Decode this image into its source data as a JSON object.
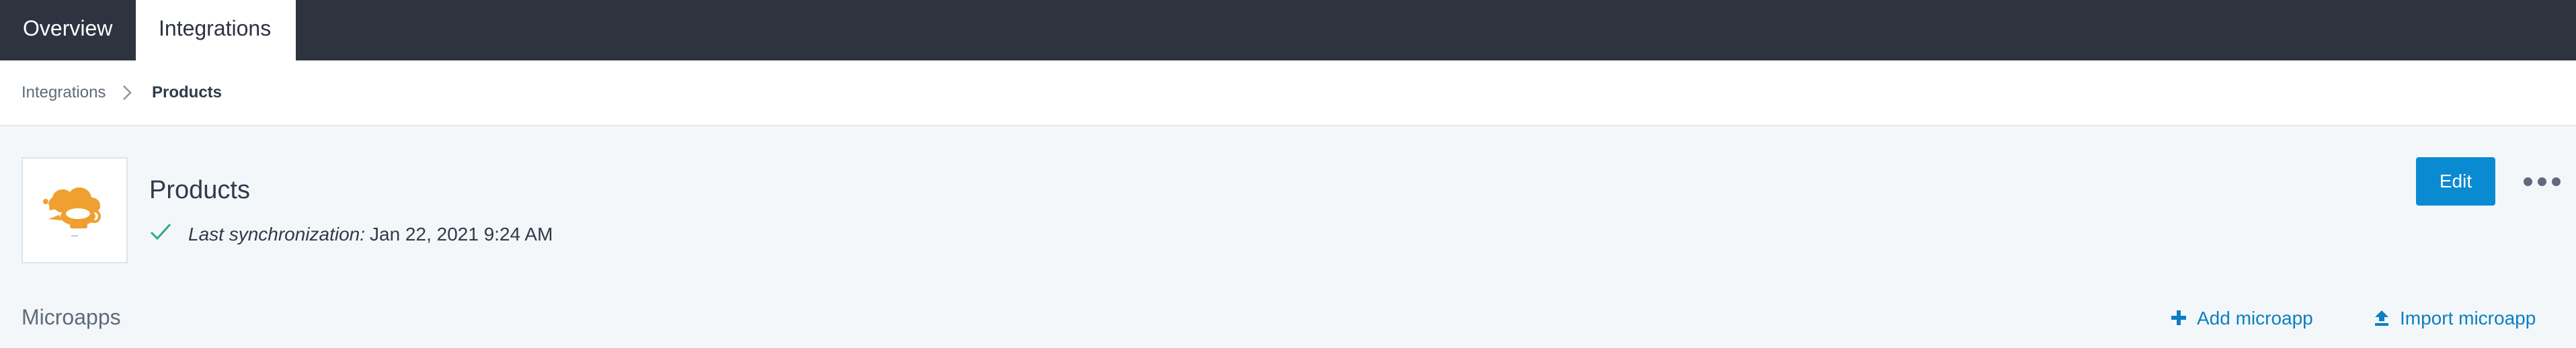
{
  "tabs": [
    {
      "label": "Overview"
    },
    {
      "label": "Integrations"
    }
  ],
  "breadcrumb": {
    "parent": "Integrations",
    "current": "Products"
  },
  "integration": {
    "title": "Products",
    "sync_label": "Last synchronization:",
    "sync_value": "Jan 22, 2021 9:24 AM",
    "edit_label": "Edit"
  },
  "microapps": {
    "title": "Microapps",
    "add_label": "Add microapp",
    "import_label": "Import microapp"
  },
  "icons": {
    "app_logo": "products-app-icon",
    "sync_status": "check-icon",
    "more": "more-options-icon",
    "add": "plus-icon",
    "import": "upload-icon",
    "breadcrumb_separator": "chevron-right-icon"
  },
  "colors": {
    "topnav_bg": "#2e3340",
    "primary": "#0a8ad1",
    "link": "#0a7fc2",
    "success": "#2eab7e",
    "logo_accent": "#f0a030"
  }
}
